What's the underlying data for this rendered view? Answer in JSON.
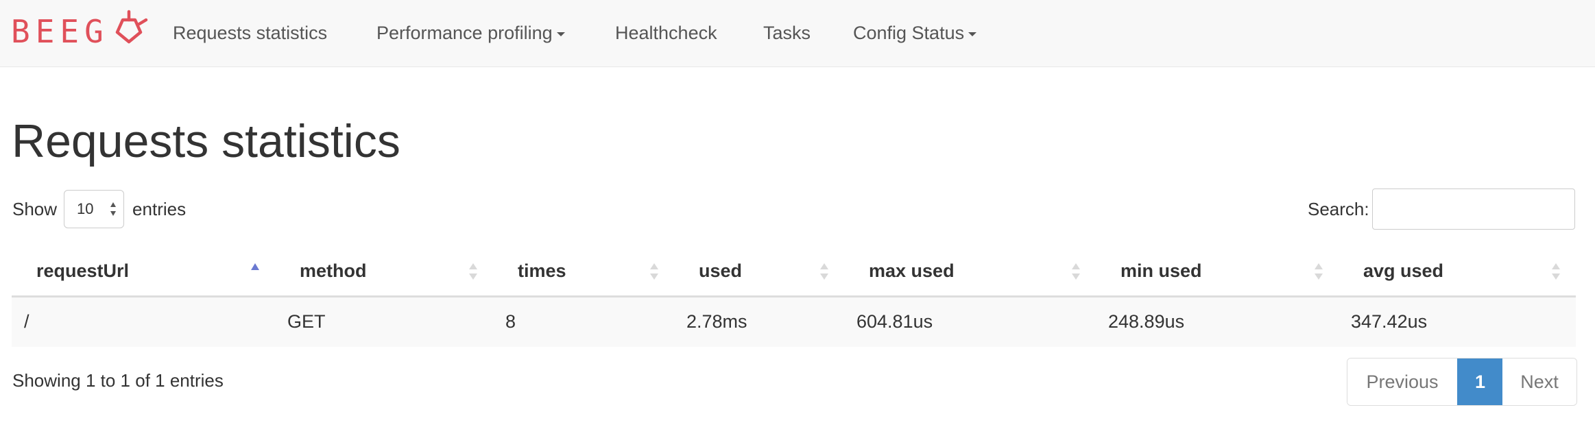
{
  "brand": {
    "name": "BEEGO",
    "text": "BEEG",
    "color": "#e0505a"
  },
  "nav": {
    "items": [
      {
        "label": "Requests statistics",
        "dropdown": false
      },
      {
        "label": "Performance profiling",
        "dropdown": true
      },
      {
        "label": "Healthcheck",
        "dropdown": false
      },
      {
        "label": "Tasks",
        "dropdown": false
      },
      {
        "label": "Config Status",
        "dropdown": true
      }
    ]
  },
  "page": {
    "title": "Requests statistics"
  },
  "length": {
    "show_label": "Show",
    "value": "10",
    "entries_label": "entries"
  },
  "search": {
    "label": "Search:",
    "value": "",
    "placeholder": ""
  },
  "table": {
    "columns": [
      "requestUrl",
      "method",
      "times",
      "used",
      "max used",
      "min used",
      "avg used"
    ],
    "sorted_column": "requestUrl",
    "sort_direction": "ascending",
    "rows": [
      [
        "/",
        "GET",
        "8",
        "2.78ms",
        "604.81us",
        "248.89us",
        "347.42us"
      ]
    ]
  },
  "info": {
    "text": "Showing 1 to 1 of 1 entries"
  },
  "pagination": {
    "previous": "Previous",
    "current": "1",
    "next": "Next",
    "accent": "#428bca"
  }
}
